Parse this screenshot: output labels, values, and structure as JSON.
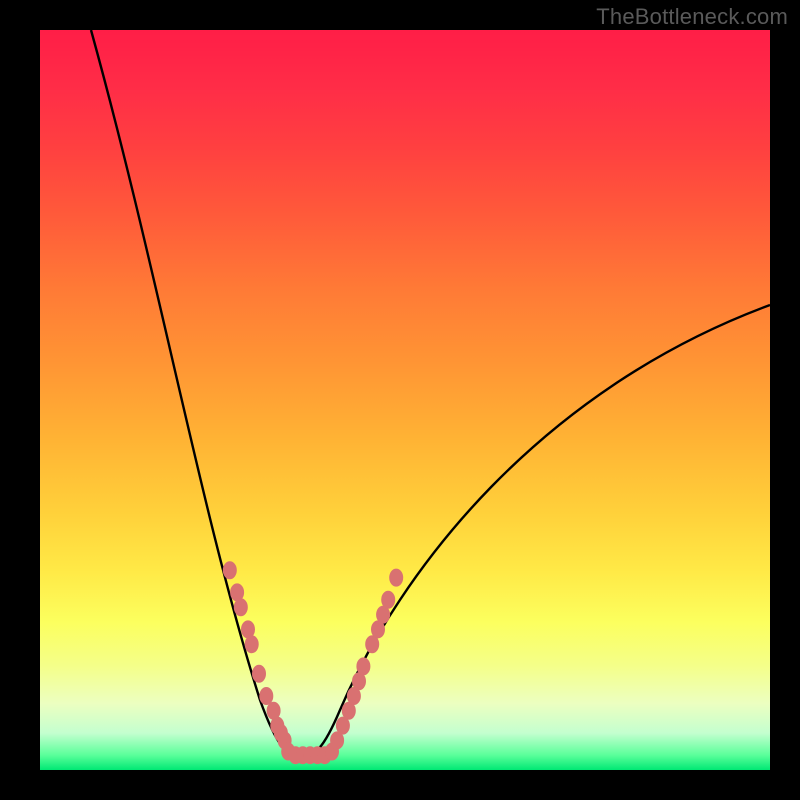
{
  "watermark": "TheBottleneck.com",
  "colors": {
    "frame": "#000000",
    "curve_stroke": "#000000",
    "marker_fill": "#d97171",
    "gradient_top": "#ff1e47",
    "gradient_mid": "#ffd03a",
    "gradient_bottom": "#00e874"
  },
  "chart_data": {
    "type": "line",
    "title": "",
    "xlabel": "",
    "ylabel": "",
    "xlim": [
      0,
      100
    ],
    "ylim": [
      0,
      100
    ],
    "curve": {
      "type": "bottleneck-v",
      "left_branch": {
        "x_start": 7,
        "y_start": 100,
        "x_end": 34,
        "y_end": 2
      },
      "minimum": {
        "x_start": 34,
        "x_end": 40,
        "y": 2
      },
      "right_branch": {
        "x_start": 40,
        "y_start": 2,
        "x_end": 100,
        "y_end": 63
      }
    },
    "series": [
      {
        "name": "markers-left",
        "x": [
          26,
          27,
          27.5,
          28.5,
          29,
          30,
          31,
          32,
          32.5,
          33,
          33.5
        ],
        "y": [
          27,
          24,
          22,
          19,
          17,
          13,
          10,
          8,
          6,
          5,
          4
        ]
      },
      {
        "name": "markers-bottom",
        "x": [
          34,
          35,
          36,
          37,
          38,
          39,
          40
        ],
        "y": [
          2.5,
          2,
          2,
          2,
          2,
          2,
          2.5
        ]
      },
      {
        "name": "markers-right",
        "x": [
          40.7,
          41.5,
          42.3,
          43,
          43.7,
          44.3,
          45.5,
          46.3,
          47,
          47.7,
          48.8
        ],
        "y": [
          4,
          6,
          8,
          10,
          12,
          14,
          17,
          19,
          21,
          23,
          26
        ]
      }
    ]
  }
}
